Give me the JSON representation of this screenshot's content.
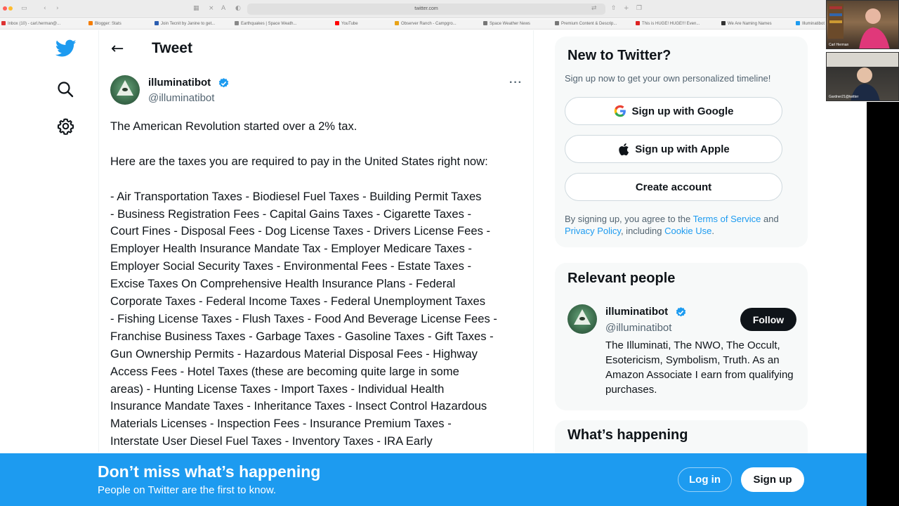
{
  "browser": {
    "url": "twitter.com",
    "bookmarks": [
      "Inbox (10) - carl.herman@...",
      "Blogger: Stats",
      "Join Tecnit by Janine to get...",
      "Earthquakes | Space Weath...",
      "YouTube",
      "Observer Ranch - Campgro...",
      "Space Weather News",
      "Premium Content & Descrip...",
      "This is HUGE! HUGE!!! Even...",
      "We Are Naming Names",
      "Illuminatibot"
    ]
  },
  "nav": {
    "items": [
      {
        "name": "twitter-logo-icon"
      },
      {
        "name": "explore-search-icon"
      },
      {
        "name": "settings-gear-icon"
      }
    ]
  },
  "header": {
    "back_icon": "←",
    "title": "Tweet"
  },
  "tweet": {
    "author_name": "illuminatibot",
    "author_handle": "@illuminatibot",
    "more_icon": "···",
    "paragraphs": [
      "The American Revolution started over a 2% tax.",
      "Here are the taxes you are required to pay in the United States right now:",
      "- Air Transportation Taxes - Biodiesel Fuel Taxes - Building Permit Taxes\n- Business Registration Fees - Capital Gains Taxes - Cigarette Taxes -\nCourt Fines - Disposal Fees - Dog License Taxes - Drivers License Fees -\nEmployer Health Insurance Mandate Tax - Employer Medicare Taxes -\nEmployer Social Security Taxes - Environmental Fees - Estate Taxes -\nExcise Taxes On Comprehensive Health Insurance Plans - Federal\nCorporate Taxes - Federal Income Taxes - Federal Unemployment Taxes\n- Fishing License Taxes - Flush Taxes - Food And Beverage License Fees -\nFranchise Business Taxes - Garbage Taxes - Gasoline Taxes - Gift Taxes -\nGun Ownership Permits - Hazardous Material Disposal Fees - Highway\nAccess Fees - Hotel Taxes (these are becoming quite large in some\nareas) - Hunting License Taxes - Import Taxes - Individual Health\nInsurance Mandate Taxes - Inheritance Taxes - Insect Control Hazardous\nMaterials Licenses - Inspection Fees - Insurance Premium Taxes -\nInterstate User Diesel Fuel Taxes - Inventory Taxes - IRA Early"
    ]
  },
  "signup_card": {
    "title": "New to Twitter?",
    "subtitle": "Sign up now to get your own personalized timeline!",
    "google_label": "Sign up with Google",
    "apple_label": "Sign up with Apple",
    "create_label": "Create account",
    "legal_prefix": "By signing up, you agree to the ",
    "terms": "Terms of Service",
    "and": " and ",
    "privacy": "Privacy Policy",
    "including": ", including ",
    "cookie": "Cookie Use",
    "period": "."
  },
  "relevant": {
    "title": "Relevant people",
    "name": "illuminatibot",
    "handle": "@illuminatibot",
    "follow_label": "Follow",
    "bio": "The Illuminati, The NWO, The Occult, Esotericism, Symbolism, Truth. As an Amazon Associate I earn from qualifying purchases."
  },
  "happening": {
    "title": "What’s happening"
  },
  "banner": {
    "title": "Don’t miss what’s happening",
    "subtitle": "People on Twitter are the first to know.",
    "login_label": "Log in",
    "signup_label": "Sign up"
  },
  "video_call": {
    "tile1_name": "Carl Herman",
    "tile2_name": "Gardner21@twitter"
  },
  "colors": {
    "brand_blue": "#1d9bf0",
    "text_primary": "#0f1419",
    "text_secondary": "#536471",
    "card_bg": "#f7f9f9"
  }
}
